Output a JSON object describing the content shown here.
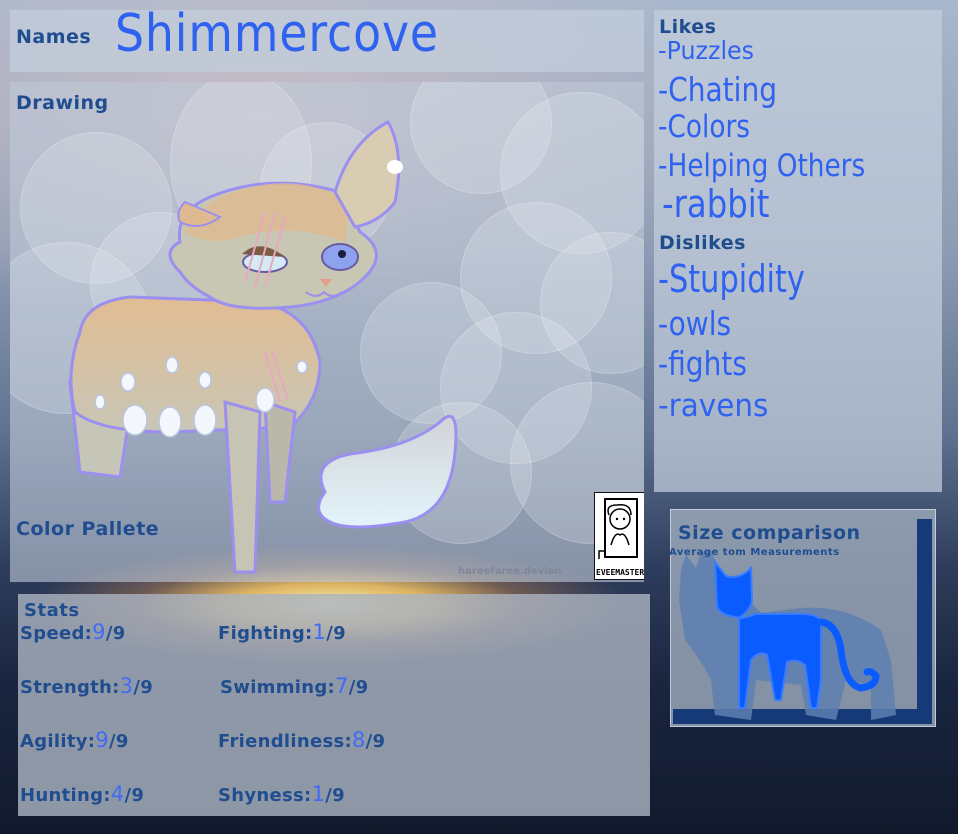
{
  "names": {
    "label": "Names",
    "value": "Shimmercove"
  },
  "drawing": {
    "label": "Drawing",
    "palette_label": "Color Pallete",
    "watermark": "hareefaree.devian",
    "artist_badge": "EVEEMASTER"
  },
  "likes": {
    "label": "Likes",
    "items": [
      "-Puzzles",
      "-Chating",
      "-Colors",
      "-Helping Others",
      "-rabbit"
    ]
  },
  "dislikes": {
    "label": "Dislikes",
    "items": [
      "-Stupidity",
      "-owls",
      "-fights",
      "-ravens"
    ]
  },
  "size_comparison": {
    "title": "Size comparison",
    "subtitle": "Average tom Measurements"
  },
  "stats": {
    "label": "Stats",
    "max": "9",
    "items": [
      {
        "name": "Speed:",
        "value": "9"
      },
      {
        "name": "Fighting:",
        "value": "1"
      },
      {
        "name": "Strength:",
        "value": "3"
      },
      {
        "name": "Swimming:",
        "value": "7"
      },
      {
        "name": "Agility:",
        "value": "9"
      },
      {
        "name": "Friendliness:",
        "value": "8"
      },
      {
        "name": "Hunting:",
        "value": "4"
      },
      {
        "name": "Shyness:",
        "value": "1"
      }
    ]
  },
  "colors": {
    "heading": "#1f4d8f",
    "handwriting": "#2f62f0",
    "cat_silhouette": "#0a5cff",
    "shadow_silhouette": "#5d7fb0",
    "frame": "#163a78",
    "outline": "#9b8ff0"
  }
}
